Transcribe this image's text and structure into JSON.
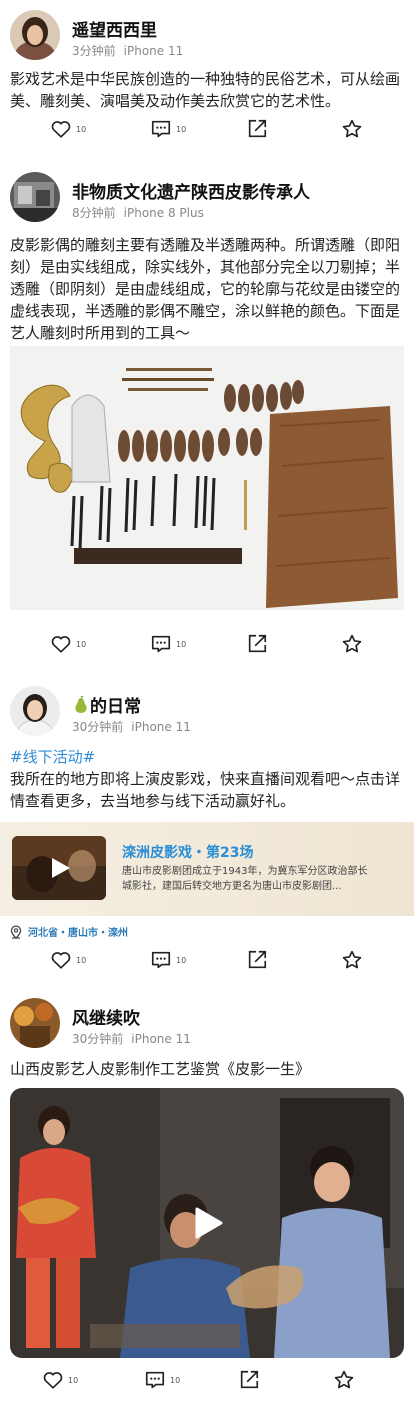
{
  "posts": [
    {
      "author": "遥望西西里",
      "time": "3分钟前",
      "device": "iPhone 11",
      "text": "影戏艺术是中华民族创造的一种独特的民俗艺术，可从绘画美、雕刻美、演唱美及动作美去欣赏它的艺术性。",
      "likes": "10",
      "comments": "10"
    },
    {
      "author": "非物质文化遗产陕西皮影传承人",
      "time": "8分钟前",
      "device": "iPhone 8 Plus",
      "text": "皮影影偶的雕刻主要有透雕及半透雕两种。所谓透雕（即阳刻）是由实线组成，除实线外，其他部分完全以刀剔掉；半透雕（即阴刻）是由虚线组成，它的轮廓与花纹是由镂空的虚线表现，半透雕的影偶不雕空，涂以鲜艳的颜色。下面是艺人雕刻时所用到的工具～",
      "likes": "10",
      "comments": "10"
    },
    {
      "author": "的日常",
      "time": "30分钟前",
      "device": "iPhone 11",
      "tag": "#线下活动#",
      "text": "我所在的地方即将上演皮影戏，快来直播间观看吧～点击详情查看更多，去当地参与线下活动赢好礼。",
      "card_title": "滦洲皮影戏・第23场",
      "card_desc": "唐山市皮影剧团成立于1943年，为冀东军分区政治部长城影社，建国后转交地方更名为唐山市皮影剧团...",
      "location": "河北省・唐山市・滦州",
      "likes": "10",
      "comments": "10"
    },
    {
      "author": "风继续吹",
      "time": "30分钟前",
      "device": "iPhone 11",
      "text": "山西皮影艺人皮影制作工艺鉴赏《皮影一生》",
      "likes": "10",
      "comments": "10"
    }
  ],
  "icons": [
    "heart-icon",
    "comment-icon",
    "share-icon",
    "star-icon",
    "play-icon",
    "location-pin-icon",
    "pear-emoji-icon"
  ],
  "colors": {
    "tag": "#2e8bd8",
    "card_title": "#2a8fd6",
    "location": "#2a7ab8",
    "card_bg": "#f2eadb"
  }
}
